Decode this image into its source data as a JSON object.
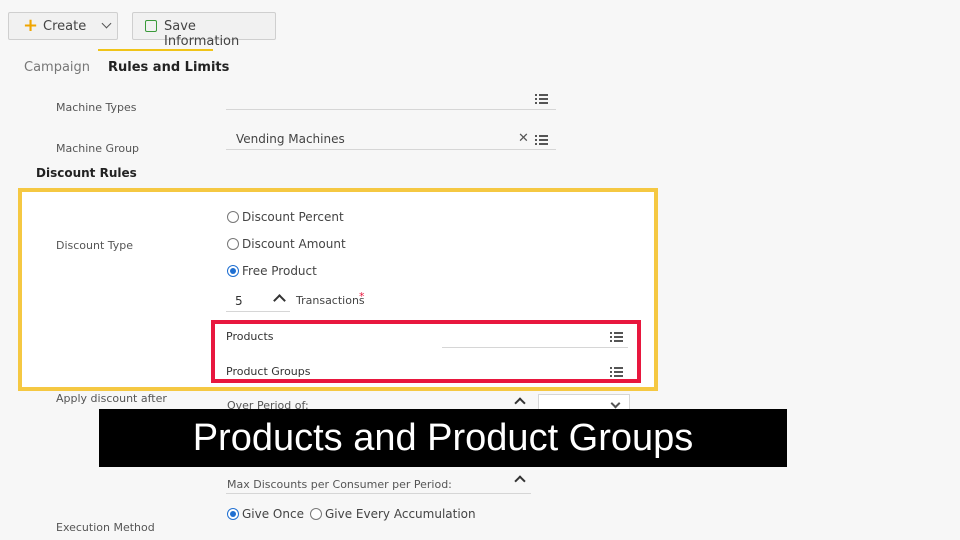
{
  "toolbar": {
    "create_label": "Create",
    "save_label": "Save Information"
  },
  "tabs": [
    {
      "label": "Campaign"
    },
    {
      "label": "Rules and Limits"
    }
  ],
  "fields": {
    "machine_types_label": "Machine Types",
    "machine_group_label": "Machine Group",
    "machine_group_value": "Vending Machines"
  },
  "discount_rules": {
    "heading": "Discount Rules",
    "discount_type_label": "Discount Type",
    "options": [
      {
        "label": "Discount Percent",
        "selected": false
      },
      {
        "label": "Discount Amount",
        "selected": false
      },
      {
        "label": "Free Product",
        "selected": true
      }
    ],
    "transactions_value": "5",
    "transactions_label": "Transactions",
    "required_mark": "*",
    "products_label": "Products",
    "product_groups_label": "Product Groups"
  },
  "apply_discount": {
    "label": "Apply discount after",
    "period_label": "Over Period of:",
    "max_label": "Max Discounts per Consumer per Period:"
  },
  "execution": {
    "label": "Execution Method",
    "options": [
      {
        "label": "Give Once",
        "selected": true
      },
      {
        "label": "Give Every Accumulation",
        "selected": false
      }
    ]
  },
  "caption": "Products and Product Groups",
  "colors": {
    "highlight_yellow": "#f5c842",
    "highlight_red": "#e8173e",
    "create_plus": "#f0a500",
    "save_icon": "#3a9a3a",
    "radio_selected": "#1f6fd1",
    "tab_underline": "#f0c419",
    "caption_bg": "#000000",
    "caption_text": "#ffffff"
  }
}
